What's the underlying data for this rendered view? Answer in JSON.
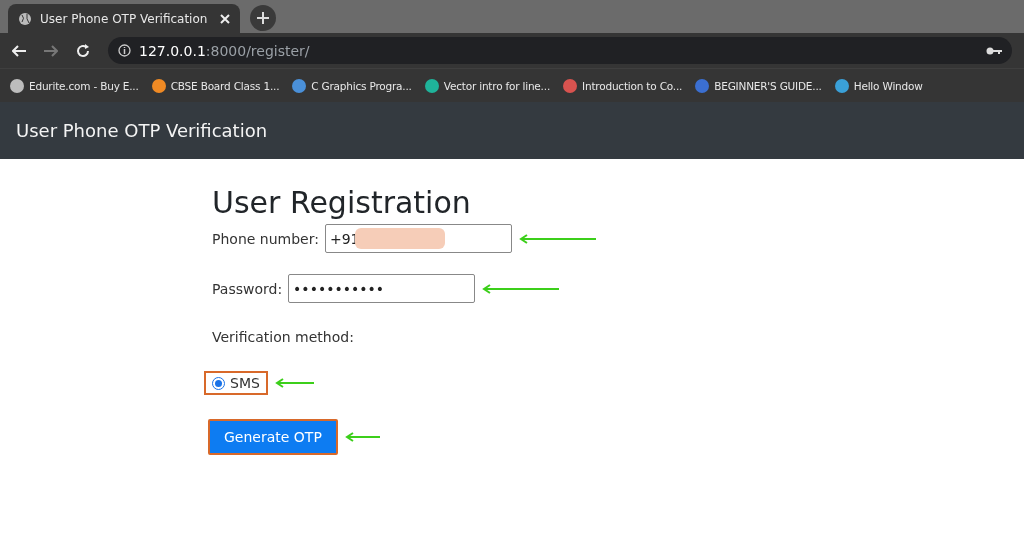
{
  "browser": {
    "tab": {
      "title": "User Phone OTP Verification",
      "selected": true
    },
    "url": {
      "host": "127.0.0.1",
      "rest": ":8000/register/"
    },
    "bookmarks": [
      {
        "label": "Edurite.com - Buy E...",
        "color": "#bdbdbd"
      },
      {
        "label": "CBSE Board Class 1...",
        "color": "#f08a24"
      },
      {
        "label": "C Graphics Progra...",
        "color": "#4a90d9"
      },
      {
        "label": "Vector intro for line...",
        "color": "#1fb39a"
      },
      {
        "label": "Introduction to Co...",
        "color": "#d9534f"
      },
      {
        "label": "BEGINNER'S GUIDE...",
        "color": "#3b6fd1"
      },
      {
        "label": "Hello Window",
        "color": "#3aa0d8"
      }
    ]
  },
  "navbar": {
    "brand": "User Phone OTP Verification"
  },
  "form": {
    "heading": "User Registration",
    "phone": {
      "label": "Phone number:",
      "value": "+91",
      "redacted": true
    },
    "password": {
      "label": "Password:",
      "value": "•••••••••••"
    },
    "method_label": "Verification method:",
    "methods": [
      {
        "label": "SMS",
        "selected": true
      }
    ],
    "submit": {
      "label": "Generate OTP"
    }
  }
}
